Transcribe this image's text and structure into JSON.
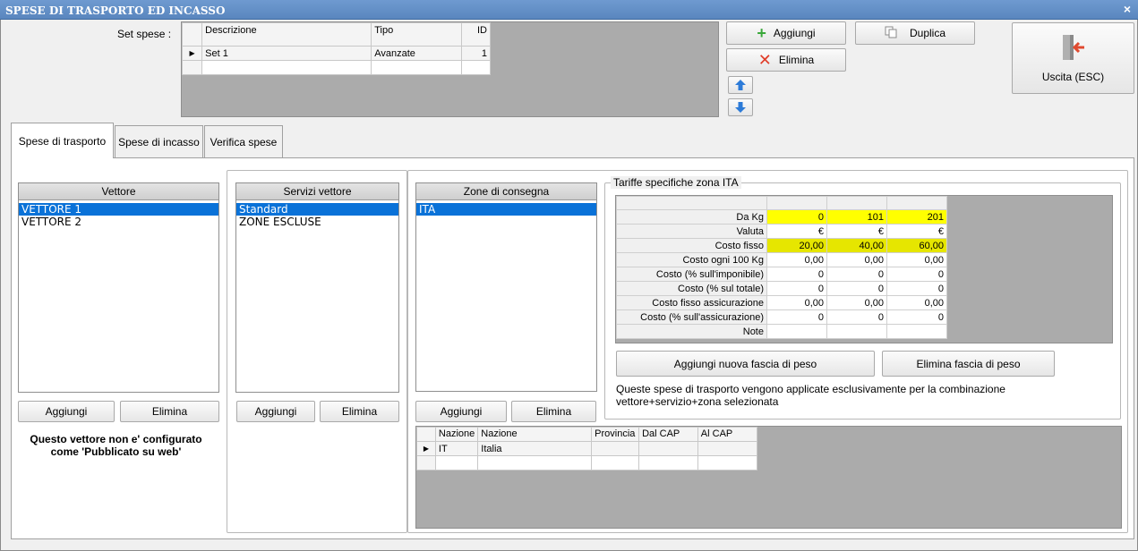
{
  "window": {
    "title": "SPESE DI TRASPORTO ED INCASSO",
    "close_glyph": "×"
  },
  "set_spese": {
    "label": "Set spese :",
    "columns": [
      "Descrizione",
      "Tipo",
      "ID"
    ],
    "rows": [
      {
        "indicator": "▶",
        "descrizione": "Set 1",
        "tipo": "Avanzate",
        "id": "1"
      }
    ]
  },
  "toolbar": {
    "aggiungi": "Aggiungi",
    "elimina": "Elimina",
    "duplica": "Duplica",
    "uscita": "Uscita (ESC)",
    "up_icon": "arrow-up-icon",
    "down_icon": "arrow-down-icon"
  },
  "tabs": [
    "Spese di trasporto",
    "Spese di incasso",
    "Verifica spese"
  ],
  "vettore": {
    "header": "Vettore",
    "items": [
      "VETTORE 1",
      "VETTORE 2"
    ],
    "selected": 0,
    "add": "Aggiungi",
    "remove": "Elimina",
    "note": "Questo vettore non e' configurato",
    "note2": "come 'Pubblicato su web'"
  },
  "servizi": {
    "header": "Servizi vettore",
    "items": [
      "Standard",
      "ZONE ESCLUSE"
    ],
    "selected": 0,
    "add": "Aggiungi",
    "remove": "Elimina"
  },
  "zone": {
    "header": "Zone di consegna",
    "items": [
      "ITA"
    ],
    "selected": 0,
    "add": "Aggiungi",
    "remove": "Elimina"
  },
  "tariffe": {
    "legend": "Tariffe specifiche zona ITA",
    "rows": [
      {
        "label": "Da Kg",
        "values": [
          "0",
          "101",
          "201"
        ],
        "style": "y1"
      },
      {
        "label": "Valuta",
        "values": [
          "€",
          "€",
          "€"
        ],
        "style": ""
      },
      {
        "label": "Costo fisso",
        "values": [
          "20,00",
          "40,00",
          "60,00"
        ],
        "style": "y2"
      },
      {
        "label": "Costo ogni 100 Kg",
        "values": [
          "0,00",
          "0,00",
          "0,00"
        ],
        "style": ""
      },
      {
        "label": "Costo (% sull'imponibile)",
        "values": [
          "0",
          "0",
          "0"
        ],
        "style": ""
      },
      {
        "label": "Costo (% sul totale)",
        "values": [
          "0",
          "0",
          "0"
        ],
        "style": ""
      },
      {
        "label": "Costo fisso assicurazione",
        "values": [
          "0,00",
          "0,00",
          "0,00"
        ],
        "style": ""
      },
      {
        "label": "Costo (% sull'assicurazione)",
        "values": [
          "0",
          "0",
          "0"
        ],
        "style": ""
      },
      {
        "label": "Note",
        "values": [
          "",
          "",
          ""
        ],
        "style": ""
      }
    ],
    "add_band": "Aggiungi nuova fascia di peso",
    "remove_band": "Elimina fascia di peso",
    "info_line1": "Queste spese di trasporto vengono applicate esclusivamente per la combinazione",
    "info_line2": "vettore+servizio+zona selezionata"
  },
  "nazioni": {
    "columns": [
      "Nazione",
      "Nazione",
      "Provincia",
      "Dal CAP",
      "Al CAP"
    ],
    "rows": [
      {
        "indicator": "▶",
        "cells": [
          "IT",
          "Italia",
          "",
          "",
          ""
        ]
      }
    ]
  },
  "colors": {
    "selection": "#0a72d8",
    "yellow": "#ffff00",
    "olive_yellow": "#e6e600",
    "titlebar": "#5a86be"
  }
}
